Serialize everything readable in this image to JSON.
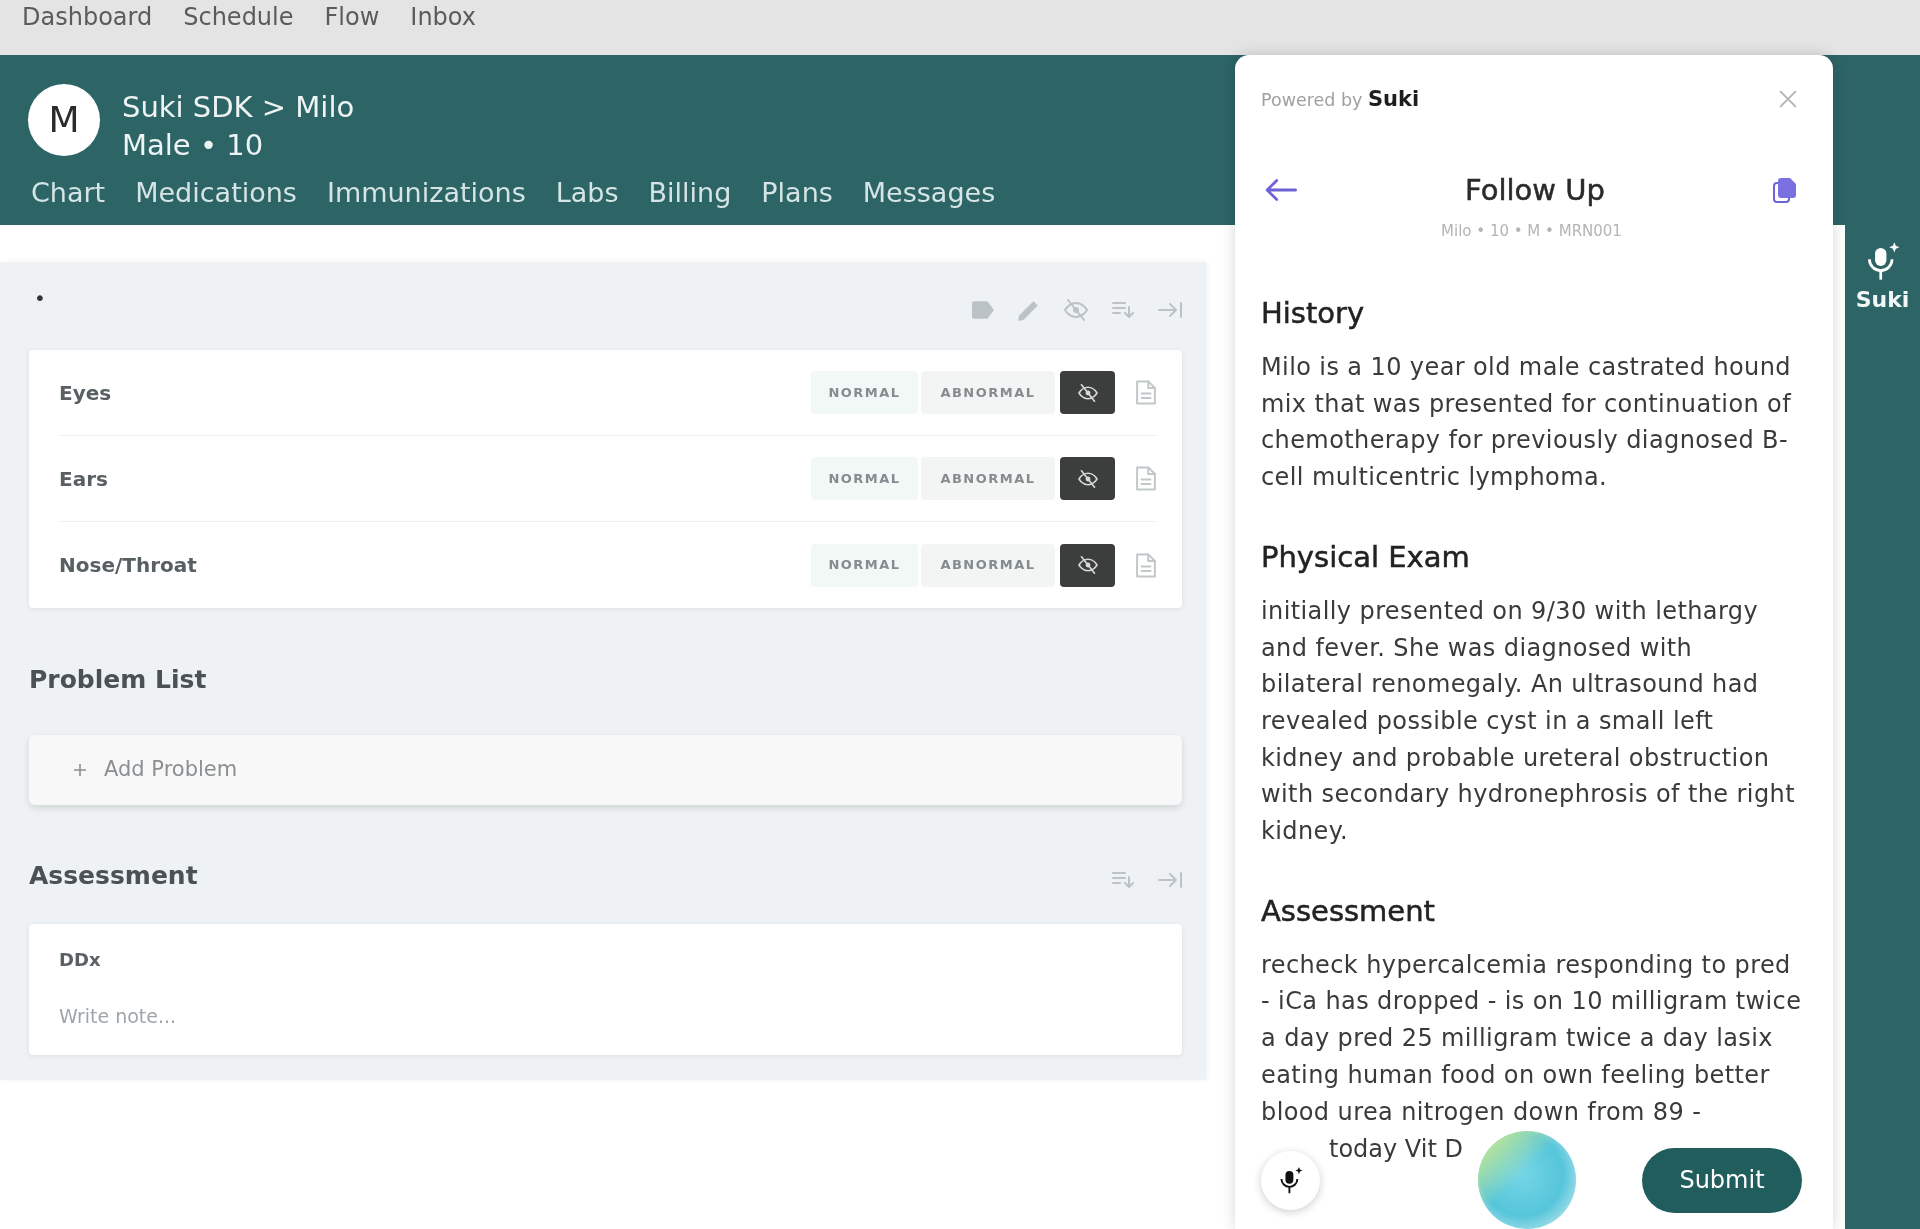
{
  "top_nav": {
    "items": [
      {
        "label": "Dashboard",
        "selected": false
      },
      {
        "label": "Schedule",
        "selected": false
      },
      {
        "label": "Flow",
        "selected": false
      },
      {
        "label": "Inbox",
        "selected": false
      }
    ]
  },
  "patient_header": {
    "avatar_initial": "M",
    "title": "Suki SDK > Milo",
    "details": "Male • 10",
    "tabs": [
      {
        "label": "Chart",
        "selected": false
      },
      {
        "label": "Medications",
        "selected": false
      },
      {
        "label": "Immunizations",
        "selected": false
      },
      {
        "label": "Labs",
        "selected": false
      },
      {
        "label": "Billing",
        "selected": false
      },
      {
        "label": "Plans",
        "selected": false
      },
      {
        "label": "Messages",
        "selected": false
      }
    ]
  },
  "exam": {
    "marker": "•",
    "rows": [
      {
        "label": "Eyes",
        "options": [
          {
            "kind": "normal",
            "label": "NORMAL",
            "selected": false
          },
          {
            "kind": "abnormal",
            "label": "ABNORMAL",
            "selected": false
          }
        ],
        "hidden": true
      },
      {
        "label": "Ears",
        "options": [
          {
            "kind": "normal",
            "label": "NORMAL",
            "selected": false
          },
          {
            "kind": "abnormal",
            "label": "ABNORMAL",
            "selected": false
          }
        ],
        "hidden": true
      },
      {
        "label": "Nose/Throat",
        "options": [
          {
            "kind": "normal",
            "label": "NORMAL",
            "selected": false
          },
          {
            "kind": "abnormal",
            "label": "ABNORMAL",
            "selected": false
          }
        ],
        "hidden": true
      }
    ]
  },
  "problem_list": {
    "title": "Problem List",
    "add_label": "Add Problem"
  },
  "assessment": {
    "title": "Assessment",
    "fields": [
      {
        "label": "DDx",
        "placeholder": "Write note..."
      }
    ]
  },
  "assistant_panel": {
    "powered_by": "Powered by **Suki**",
    "title": "Follow Up",
    "subtitle": "Milo • 10 • M • MRN001",
    "sections": [
      {
        "heading": "History",
        "body": "Milo is a 10 year old male castrated hound mix that was presented for continuation of chemotherapy for previously diagnosed B-cell multicentric lymphoma."
      },
      {
        "heading": "Physical Exam",
        "body": "initially presented on 9/30 with lethargy and fever. She was diagnosed with bilateral renomegaly. An ultrasound had revealed possible cyst in a small left kidney and probable ureteral obstruction with secondary hydronephrosis of the right kidney."
      },
      {
        "heading": "Assessment",
        "body": "recheck hypercalcemia responding to pred - iCa has dropped - is on 10 milligram twice a day pred 25 milligram twice a day lasix eating human food on own feeling better blood urea nitrogen down from 89 -"
      }
    ],
    "partial_line": "today Vit D",
    "submit": "Submit"
  },
  "side_strip": {
    "label": "Suki"
  }
}
